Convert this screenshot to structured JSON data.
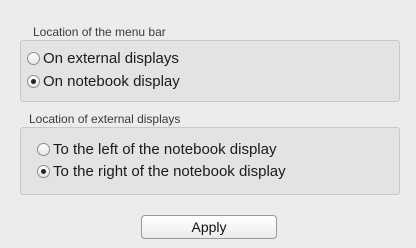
{
  "menu_bar_group": {
    "title": "Location of the menu bar",
    "options": [
      {
        "label": "On external displays",
        "selected": false
      },
      {
        "label": "On notebook display",
        "selected": true
      }
    ]
  },
  "external_displays_group": {
    "title": "Location of external displays",
    "options": [
      {
        "label": "To the left of the notebook display",
        "selected": false
      },
      {
        "label": "To the right of the notebook display",
        "selected": true
      }
    ]
  },
  "apply_button": {
    "label": "Apply"
  }
}
